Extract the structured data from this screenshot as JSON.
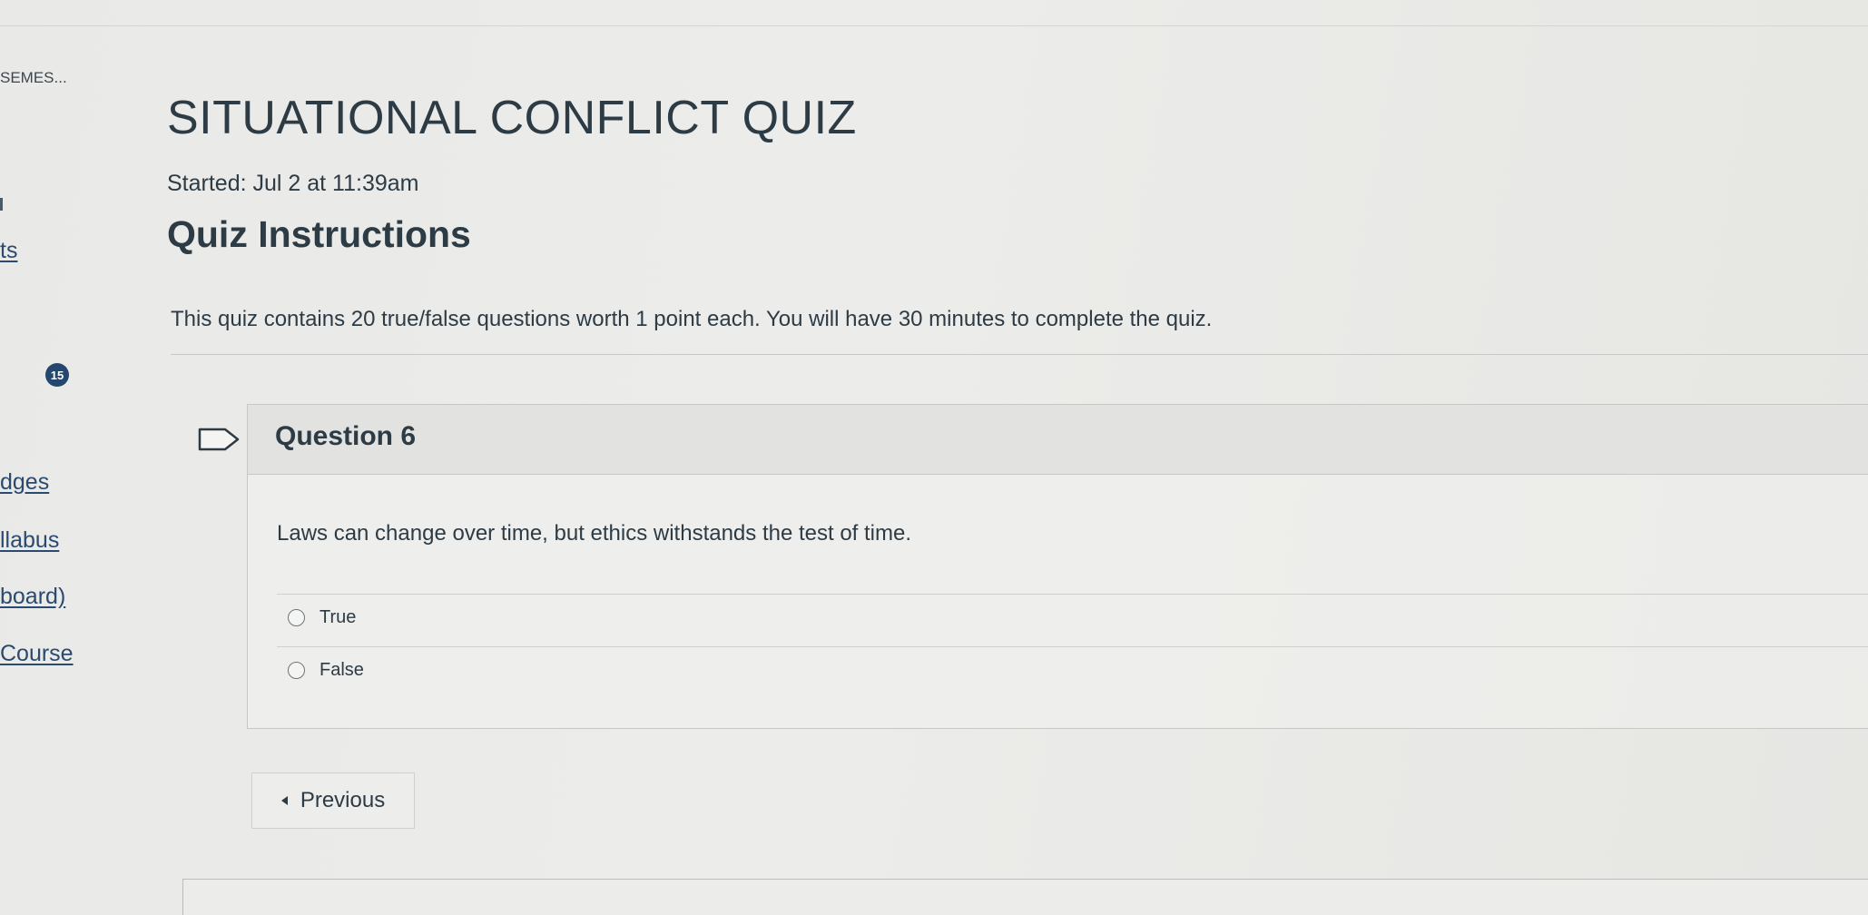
{
  "breadcrumb": "SEMES...",
  "nav": {
    "fragments": [
      "ts",
      "dges",
      "llabus",
      "board)",
      "Course"
    ],
    "badge_count": "15"
  },
  "quiz": {
    "title": "SITUATIONAL CONFLICT QUIZ",
    "started": "Started: Jul 2 at 11:39am",
    "instructions_heading": "Quiz Instructions",
    "instructions_text": "This quiz contains 20 true/false questions worth 1 point each. You will have 30 minutes to complete the quiz."
  },
  "question": {
    "title": "Question 6",
    "text": "Laws can change over time, but ethics withstands the test of time.",
    "answers": [
      "True",
      "False"
    ],
    "selected": null
  },
  "navigation": {
    "previous_label": "Previous"
  },
  "icons": {
    "flag": "flag-question-icon",
    "previous": "caret-left-icon"
  }
}
